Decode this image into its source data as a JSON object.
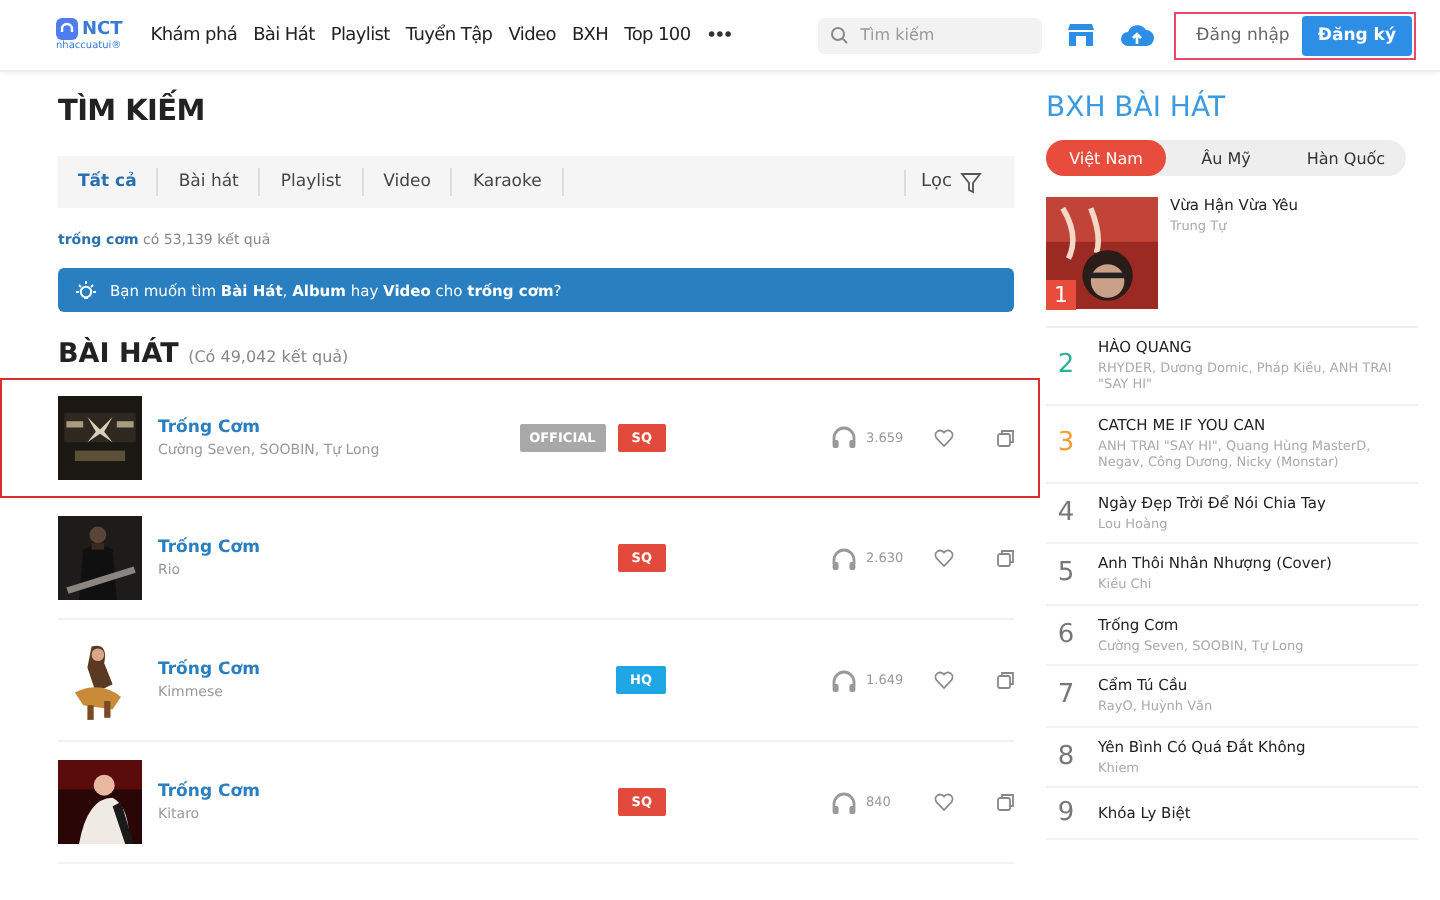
{
  "header": {
    "logo": "NCT",
    "logo_sub": "nhaccuatui®",
    "nav": [
      "Khám phá",
      "Bài Hát",
      "Playlist",
      "Tuyển Tập",
      "Video",
      "BXH",
      "Top 100"
    ],
    "more": "•••",
    "search": {
      "placeholder": "Tìm kiếm"
    },
    "login": "Đăng nhập",
    "register": "Đăng ký",
    "auth_highlighted": true
  },
  "search": {
    "title": "TÌM KIẾM",
    "tabs": [
      {
        "label": "Tất cả",
        "selected": true
      },
      {
        "label": "Bài hát",
        "selected": false
      },
      {
        "label": "Playlist",
        "selected": false
      },
      {
        "label": "Video",
        "selected": false
      },
      {
        "label": "Karaoke",
        "selected": false
      }
    ],
    "filter": "Lọc",
    "query": "trống cơm",
    "result_count": "có 53,139 kết quả",
    "suggestion": "Bạn muốn tìm **Bài Hát**, **Album** hay **Video** cho **trống cơm**?",
    "songs_title": "BÀI HÁT",
    "songs_count": "(Có 49,042 kết quả)",
    "songs": [
      {
        "title": "Trống Cơm",
        "artists": "Cường Seven, SOOBIN, Tự Long",
        "official": "OFFICIAL",
        "quality": "SQ",
        "listens": "3.659",
        "highlighted": true
      },
      {
        "title": "Trống Cơm",
        "artists": "Rio",
        "quality": "SQ",
        "listens": "2.630",
        "highlighted": false
      },
      {
        "title": "Trống Cơm",
        "artists": "Kimmese",
        "quality": "HQ",
        "listens": "1.649",
        "highlighted": false
      },
      {
        "title": "Trống Cơm",
        "artists": "Kitaro",
        "quality": "SQ",
        "listens": "840",
        "highlighted": false
      }
    ]
  },
  "chart": {
    "title": "BXH BÀI HÁT",
    "tabs": [
      {
        "label": "Việt Nam",
        "selected": true
      },
      {
        "label": "Âu Mỹ",
        "selected": false
      },
      {
        "label": "Hàn Quốc",
        "selected": false
      }
    ],
    "items": [
      {
        "rank": "1",
        "title": "Vừa Hận Vừa Yêu",
        "artists": "Trung Tự",
        "color": "#e74c3c"
      },
      {
        "rank": "2",
        "title": "HÀO QUANG",
        "artists": "RHYDER, Dương Domic, Pháp Kiều, ANH TRAI \"SAY HI\"",
        "color": "#2bb09a"
      },
      {
        "rank": "3",
        "title": "CATCH ME IF YOU CAN",
        "artists": "ANH TRAI \"SAY HI\", Quang Hùng MasterD, Negav, Công Dương, Nicky (Monstar)",
        "color": "#f39c38"
      },
      {
        "rank": "4",
        "title": "Ngày Đẹp Trời Để Nói Chia Tay",
        "artists": "Lou Hoàng",
        "color": "#777777"
      },
      {
        "rank": "5",
        "title": "Anh Thôi Nhân Nhượng (Cover)",
        "artists": "Kiều Chi",
        "color": "#777777"
      },
      {
        "rank": "6",
        "title": "Trống Cơm",
        "artists": "Cường Seven, SOOBIN, Tự Long",
        "color": "#777777"
      },
      {
        "rank": "7",
        "title": "Cẩm Tú Cầu",
        "artists": "RayO, Huỳnh Văn",
        "color": "#777777"
      },
      {
        "rank": "8",
        "title": "Yên Bình Có Quá Đắt Không",
        "artists": "Khiem",
        "color": "#777777"
      },
      {
        "rank": "9",
        "title": "Khóa Ly Biệt",
        "color": "#777777"
      }
    ]
  }
}
